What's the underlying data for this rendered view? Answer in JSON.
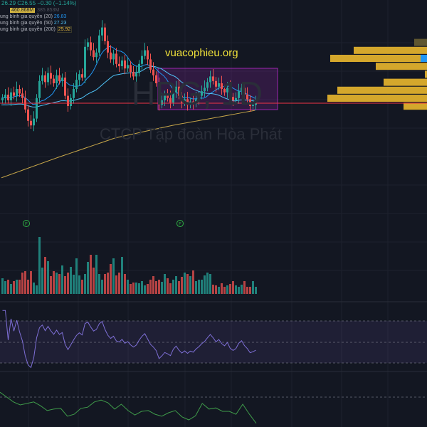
{
  "symbol_watermark": "HPG, 1D",
  "company_watermark": "CTCP Tập đoàn Hòa Phát",
  "brand_text": "vuacophieu.org",
  "legend": {
    "ohlc_text": "26.29",
    "close_text": "C26.55",
    "change_text": "−0.30 (−1.14%)",
    "volume_value": "460.868M",
    "volume_ma": "385.853M",
    "ma": [
      {
        "label": "ung bình gia quyền (20)",
        "value": "26.83",
        "color": "#2196f3"
      },
      {
        "label": "ung bình gia quyền (50)",
        "value": "27.23",
        "color": "#4fc3f7"
      },
      {
        "label": "ung bình gia quyền (200)",
        "value": "25.92",
        "color": "#f0c040"
      }
    ]
  },
  "colors": {
    "up": "#26a69a",
    "down": "#ef5350",
    "price_line": "#f23645",
    "box": "#9c27b0",
    "profile": "#d4a72c"
  },
  "current_price": 26.55,
  "closes": [
    27.0,
    27.3,
    26.8,
    27.5,
    27.2,
    27.8,
    27.4,
    27.0,
    26.0,
    25.0,
    24.6,
    25.2,
    27.0,
    28.5,
    29.0,
    28.4,
    29.2,
    28.7,
    28.3,
    29.0,
    28.5,
    28.8,
    27.2,
    26.3,
    27.0,
    27.8,
    28.6,
    29.1,
    28.8,
    31.5,
    31.9,
    31.2,
    30.6,
    31.0,
    32.5,
    33.2,
    32.0,
    31.0,
    30.4,
    30.9,
    30.0,
    29.8,
    30.3,
    29.6,
    29.9,
    29.3,
    28.9,
    29.2,
    30.0,
    30.7,
    31.2,
    30.4,
    29.5,
    29.0,
    28.3,
    26.4,
    26.8,
    27.3,
    27.0,
    26.6,
    27.5,
    28.0,
    27.2,
    26.6,
    26.9,
    26.4,
    26.7,
    26.5,
    26.9,
    27.2,
    27.6,
    27.9,
    28.4,
    28.9,
    28.5,
    28.0,
    28.3,
    27.8,
    27.5,
    27.9,
    27.1,
    26.8,
    27.0,
    27.6,
    27.9,
    27.3,
    26.9,
    26.3,
    26.4,
    26.55
  ],
  "volumes": [
    22,
    18,
    20,
    14,
    18,
    20,
    20,
    30,
    32,
    20,
    32,
    16,
    12,
    80,
    37,
    52,
    46,
    25,
    32,
    30,
    28,
    40,
    25,
    30,
    38,
    27,
    50,
    26,
    20,
    28,
    45,
    55,
    37,
    55,
    28,
    20,
    28,
    30,
    42,
    50,
    26,
    30,
    52,
    28,
    20,
    14,
    16,
    16,
    15,
    18,
    12,
    14,
    20,
    25,
    18,
    20,
    17,
    28,
    22,
    15,
    20,
    25,
    18,
    24,
    30,
    28,
    25,
    33,
    18,
    20,
    20,
    26,
    30,
    28,
    13,
    12,
    10,
    15,
    10,
    12,
    14,
    18,
    12,
    10,
    13,
    18,
    10,
    10,
    18,
    10
  ],
  "ma200_anchors": [
    [
      0,
      20.0
    ],
    [
      20,
      21.8
    ],
    [
      40,
      23.5
    ],
    [
      60,
      24.6
    ],
    [
      80,
      25.5
    ],
    [
      89,
      25.92
    ]
  ],
  "oscillator": [
    93,
    80,
    67,
    59,
    63,
    67,
    57,
    44,
    48,
    50,
    29,
    34,
    50,
    53,
    67,
    72,
    65,
    48,
    61,
    44,
    32,
    42,
    44,
    34,
    29,
    38,
    44,
    27,
    19,
    30,
    63,
    48,
    51,
    42,
    42,
    34,
    61,
    34,
    10
  ],
  "volume_profile": [
    {
      "price_from": 31.5,
      "volume": 18,
      "dim": true
    },
    {
      "price_from": 30.8,
      "volume": 103
    },
    {
      "price_from": 30.1,
      "volume": 136,
      "poc_marker": true
    },
    {
      "price_from": 29.4,
      "volume": 72
    },
    {
      "price_from": 28.7,
      "volume": 3
    },
    {
      "price_from": 28.0,
      "volume": 61
    },
    {
      "price_from": 27.3,
      "volume": 126
    },
    {
      "price_from": 26.6,
      "volume": 140
    },
    {
      "price_from": 25.9,
      "volume": 33
    }
  ],
  "events": [
    {
      "label": "F",
      "index": 8
    },
    {
      "label": "F",
      "index": 62
    }
  ]
}
